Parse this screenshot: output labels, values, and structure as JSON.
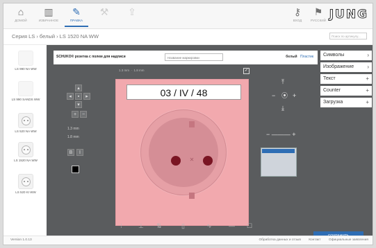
{
  "nav": {
    "items": [
      {
        "label": "ДОМОЙ",
        "icon": "home-icon",
        "glyph": "⌂",
        "state": "normal"
      },
      {
        "label": "ИЗБРАННОЕ",
        "icon": "favorites-icon",
        "glyph": "▥",
        "state": "normal"
      },
      {
        "label": "ПРАВКА",
        "icon": "pencil-icon",
        "glyph": "✎",
        "state": "active"
      },
      {
        "label": "",
        "icon": "tools-icon",
        "glyph": "⚒",
        "state": "disabled"
      },
      {
        "label": "",
        "icon": "share-icon",
        "glyph": "⇪",
        "state": "disabled"
      }
    ],
    "right": [
      {
        "label": "ВХОД",
        "icon": "key-icon",
        "glyph": "⚷"
      },
      {
        "label": "РУССКИЙ",
        "icon": "flag-icon",
        "glyph": "⚑"
      }
    ],
    "logo": "JUNG"
  },
  "breadcrumb": "Серия LS › белый › LS 1520 NA WW",
  "search": {
    "placeholder": "Поиск по артикулу..."
  },
  "products": [
    {
      "name": "LS 990 NA WW"
    },
    {
      "name": "LS 990 SANDS WW"
    },
    {
      "name": "LS 520 NA WW"
    },
    {
      "name": "LS 1520 NA WW"
    },
    {
      "name": "LS 520 KI WW"
    }
  ],
  "editor": {
    "title": "SCHUKO® розетка с полем для надписи",
    "input_value": "Название маркировки",
    "color_label": "белый",
    "material_label": "Пластик",
    "plate_text": "03 / IV / 48",
    "font_size_a": "1.3 mm",
    "font_size_b": "1.8 mm"
  },
  "menu": [
    {
      "label": "Символы",
      "glyph": "›"
    },
    {
      "label": "Изображение",
      "glyph": "›"
    },
    {
      "label": "Текст",
      "glyph": "+"
    },
    {
      "label": "Counter",
      "glyph": "+"
    },
    {
      "label": "Загрузка",
      "glyph": "+"
    }
  ],
  "send_label": "СОХРАНИТЬ",
  "footer": {
    "version": "Version 1.0.13",
    "links": [
      "Обработка данных и отзыв",
      "Контакт",
      "Официальные заявления"
    ]
  }
}
